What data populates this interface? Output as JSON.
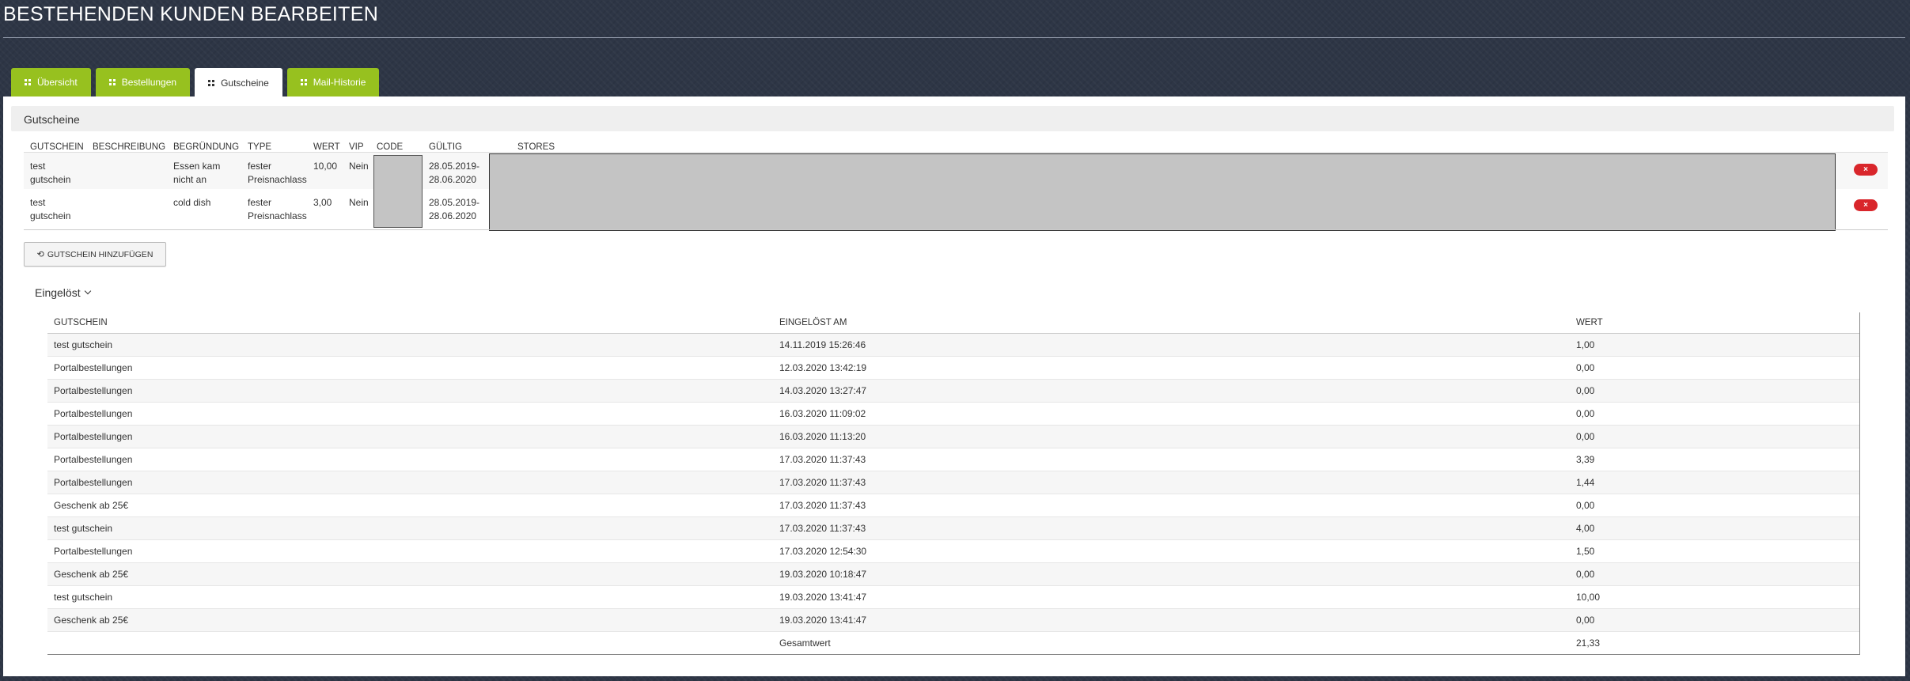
{
  "page_title": "BESTEHENDEN KUNDEN BEARBEITEN",
  "tabs": [
    {
      "label": "Übersicht",
      "active": false
    },
    {
      "label": "Bestellungen",
      "active": false
    },
    {
      "label": "Gutscheine",
      "active": true
    },
    {
      "label": "Mail-Historie",
      "active": false
    }
  ],
  "vouchers": {
    "section_title": "Gutscheine",
    "headers": {
      "gutschein": "GUTSCHEIN",
      "beschreibung": "BESCHREIBUNG",
      "begruendung": "BEGRÜNDUNG",
      "type": "TYPE",
      "wert": "WERT",
      "vip": "VIP",
      "code": "CODE",
      "gueltig": "GÜLTIG",
      "stores": "STORES"
    },
    "rows": [
      {
        "gutschein": "test gutschein",
        "beschreibung": "",
        "begruendung": "Essen kam nicht an",
        "type": "fester Preisnachlass",
        "wert": "10,00",
        "vip": "Nein",
        "gueltig": "28.05.2019-28.06.2020",
        "delete_label": "×"
      },
      {
        "gutschein": "test gutschein",
        "beschreibung": "",
        "begruendung": "cold dish",
        "type": "fester Preisnachlass",
        "wert": "3,00",
        "vip": "Nein",
        "gueltig": "28.05.2019-28.06.2020",
        "delete_label": "×"
      }
    ],
    "add_button_label": "GUTSCHEIN HINZUFÜGEN"
  },
  "redeemed": {
    "toggle_label": "Eingelöst",
    "headers": {
      "gutschein": "GUTSCHEIN",
      "eingeloest_am": "EINGELÖST AM",
      "wert": "WERT"
    },
    "rows": [
      {
        "gutschein": "test gutschein",
        "eingeloest_am": "14.11.2019 15:26:46",
        "wert": "1,00"
      },
      {
        "gutschein": "Portalbestellungen",
        "eingeloest_am": "12.03.2020 13:42:19",
        "wert": "0,00"
      },
      {
        "gutschein": "Portalbestellungen",
        "eingeloest_am": "14.03.2020 13:27:47",
        "wert": "0,00"
      },
      {
        "gutschein": "Portalbestellungen",
        "eingeloest_am": "16.03.2020 11:09:02",
        "wert": "0,00"
      },
      {
        "gutschein": "Portalbestellungen",
        "eingeloest_am": "16.03.2020 11:13:20",
        "wert": "0,00"
      },
      {
        "gutschein": "Portalbestellungen",
        "eingeloest_am": "17.03.2020 11:37:43",
        "wert": "3,39"
      },
      {
        "gutschein": "Portalbestellungen",
        "eingeloest_am": "17.03.2020 11:37:43",
        "wert": "1,44"
      },
      {
        "gutschein": "Geschenk ab 25€",
        "eingeloest_am": "17.03.2020 11:37:43",
        "wert": "0,00"
      },
      {
        "gutschein": "test gutschein",
        "eingeloest_am": "17.03.2020 11:37:43",
        "wert": "4,00"
      },
      {
        "gutschein": "Portalbestellungen",
        "eingeloest_am": "17.03.2020 12:54:30",
        "wert": "1,50"
      },
      {
        "gutschein": "Geschenk ab 25€",
        "eingeloest_am": "19.03.2020 10:18:47",
        "wert": "0,00"
      },
      {
        "gutschein": "test gutschein",
        "eingeloest_am": "19.03.2020 13:41:47",
        "wert": "10,00"
      },
      {
        "gutschein": "Geschenk ab 25€",
        "eingeloest_am": "19.03.2020 13:41:47",
        "wert": "0,00"
      }
    ],
    "total_label": "Gesamtwert",
    "total_value": "21,33"
  }
}
